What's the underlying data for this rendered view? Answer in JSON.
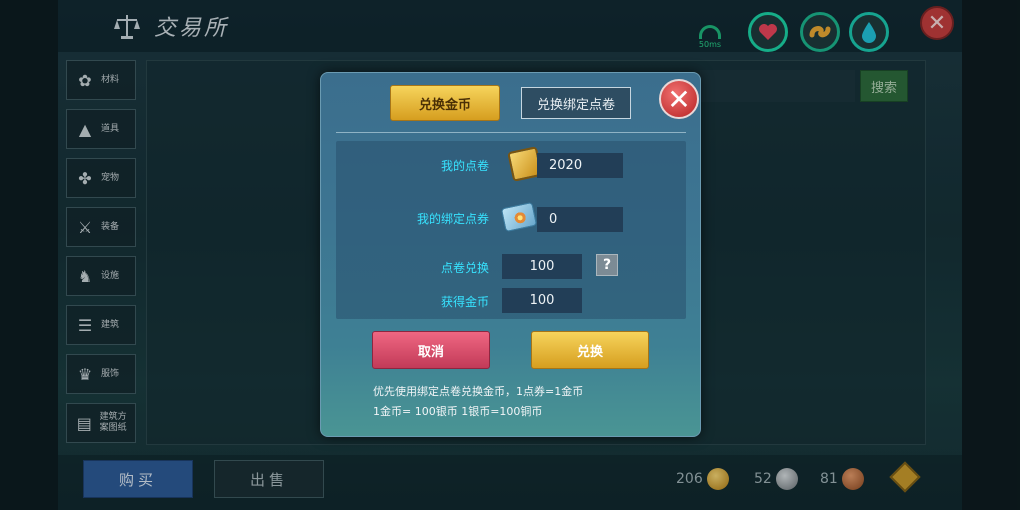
{
  "header": {
    "title": "交易所"
  },
  "status": {
    "ping": "50ms"
  },
  "sidebar": {
    "items": [
      {
        "label": "材料",
        "icon": "material-icon"
      },
      {
        "label": "道具",
        "icon": "item-icon"
      },
      {
        "label": "宠物",
        "icon": "paw-icon"
      },
      {
        "label": "装备",
        "icon": "equipment-icon"
      },
      {
        "label": "设施",
        "icon": "facility-icon"
      },
      {
        "label": "建筑",
        "icon": "building-icon"
      },
      {
        "label": "服饰",
        "icon": "clothing-icon"
      },
      {
        "label": "建筑方案图纸",
        "icon": "blueprint-icon"
      }
    ]
  },
  "search": {
    "label": "搜索"
  },
  "bottom": {
    "buy": "购买",
    "sell": "出售",
    "gold": "206",
    "silver": "52",
    "copper": "81"
  },
  "dialog": {
    "tab_gold": "兑换金币",
    "tab_bound": "兑换绑定点卷",
    "rows": {
      "my_points_label": "我的点卷",
      "my_points_value": "2020",
      "my_bound_label": "我的绑定点券",
      "my_bound_value": "0",
      "exchange_label": "点卷兑换",
      "exchange_value": "100",
      "gain_label": "获得金币",
      "gain_value": "100"
    },
    "cancel": "取消",
    "confirm": "兑换",
    "note1": "优先使用绑定点卷兑换金币，1点券=1金币",
    "note2": "1金币= 100银币 1银币=100铜币"
  },
  "colors": {
    "accent_cyan": "#37e3ff",
    "gold_button": "#f6d45c",
    "cancel_button": "#ef6782"
  }
}
